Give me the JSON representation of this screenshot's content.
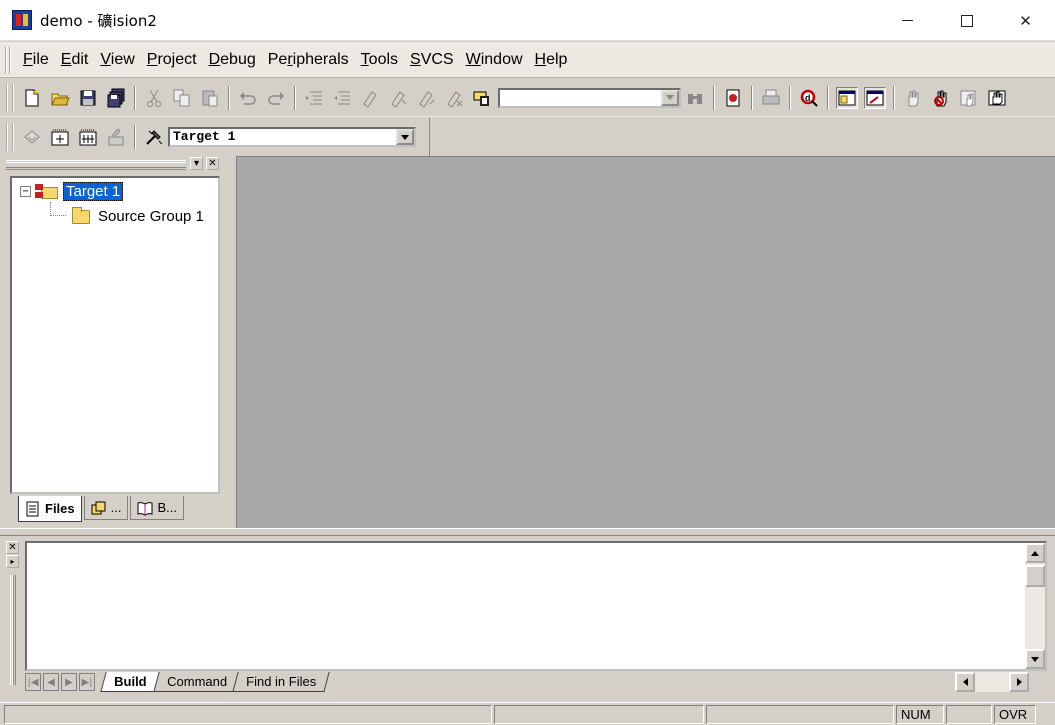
{
  "window": {
    "title": "demo  - 礦ision2",
    "controls": [
      "minimize",
      "maximize",
      "close"
    ]
  },
  "menu": {
    "items": [
      {
        "label": "File",
        "accel": "F",
        "rest": "ile"
      },
      {
        "label": "Edit",
        "accel": "E",
        "rest": "dit"
      },
      {
        "label": "View",
        "accel": "V",
        "rest": "iew"
      },
      {
        "label": "Project",
        "accel": "P",
        "rest": "roject"
      },
      {
        "label": "Debug",
        "accel": "D",
        "rest": "ebug"
      },
      {
        "label": "Peripherals",
        "pre": "Pe",
        "accel": "r",
        "rest": "ipherals"
      },
      {
        "label": "Tools",
        "accel": "T",
        "rest": "ools"
      },
      {
        "label": "SVCS",
        "accel": "S",
        "rest": "VCS"
      },
      {
        "label": "Window",
        "accel": "W",
        "rest": "indow"
      },
      {
        "label": "Help",
        "accel": "H",
        "rest": "elp"
      }
    ]
  },
  "toolbar2": {
    "target_select": "Target 1"
  },
  "workspace": {
    "tree": {
      "root": "Target 1",
      "child": "Source Group 1"
    },
    "tabs": [
      "Files",
      "...",
      "B..."
    ]
  },
  "output": {
    "tabs": [
      "Build",
      "Command",
      "Find in Files"
    ]
  },
  "status": {
    "num": "NUM",
    "ovr": "OVR"
  },
  "colors": {
    "selection": "#0a64d8",
    "mdi_background": "#a9a9a9",
    "chrome": "#d4d0c8"
  }
}
